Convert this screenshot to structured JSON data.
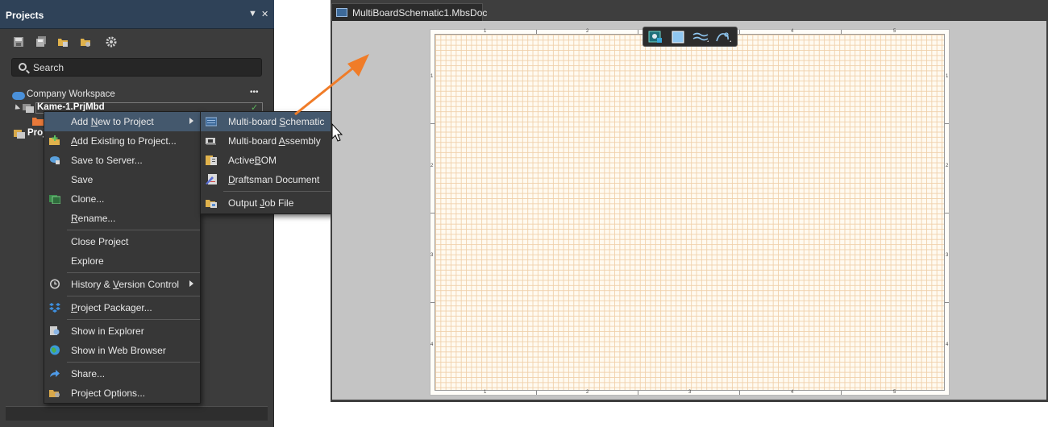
{
  "projects_panel": {
    "title": "Projects",
    "header_buttons": {
      "menu": "▼",
      "close": "✕"
    },
    "toolbar_icons": [
      "save-icon",
      "save-all-icon",
      "open-folder-icon",
      "folder-settings-icon",
      "gear-icon"
    ],
    "search": {
      "placeholder": "Search",
      "value": ""
    },
    "tree": {
      "workspace": "Company Workspace",
      "workspace_more": "•••",
      "project": "Kame-1.PrjMbd",
      "project_fragment": "Proj"
    }
  },
  "context_menu": {
    "items": [
      {
        "label_pre": "Add ",
        "label_key": "N",
        "label_post": "ew to Project",
        "icon": "none",
        "has_submenu": true,
        "highlighted": true
      },
      {
        "label_pre": "",
        "label_key": "A",
        "label_post": "dd Existing to Project...",
        "icon": "add-existing-icon"
      },
      {
        "label_pre": "Save to Server...",
        "label_key": "",
        "label_post": "",
        "icon": "cloud-save-icon"
      },
      {
        "label_pre": "Save",
        "label_key": "",
        "label_post": "",
        "icon": "none"
      },
      {
        "label_pre": "Clone...",
        "label_key": "",
        "label_post": "",
        "icon": "clone-icon"
      },
      {
        "label_pre": "",
        "label_key": "R",
        "label_post": "ename...",
        "icon": "none"
      },
      {
        "label_pre": "Close Project",
        "label_key": "",
        "label_post": "",
        "icon": "none"
      },
      {
        "label_pre": "Explore",
        "label_key": "",
        "label_post": "",
        "icon": "none"
      },
      {
        "label_pre": "History & ",
        "label_key": "V",
        "label_post": "ersion Control",
        "icon": "history-icon",
        "has_submenu": true
      },
      {
        "label_pre": "",
        "label_key": "P",
        "label_post": "roject Packager...",
        "icon": "dropbox-icon"
      },
      {
        "label_pre": "Show in Explorer",
        "label_key": "",
        "label_post": "",
        "icon": "explorer-icon"
      },
      {
        "label_pre": "Show in Web Browser",
        "label_key": "",
        "label_post": "",
        "icon": "globe-icon"
      },
      {
        "label_pre": "Share...",
        "label_key": "",
        "label_post": "",
        "icon": "share-icon"
      },
      {
        "label_pre": "Project Options...",
        "label_key": "",
        "label_post": "",
        "icon": "project-options-icon"
      }
    ]
  },
  "submenu": {
    "items": [
      {
        "label_pre": "Multi-board ",
        "label_key": "S",
        "label_post": "chematic",
        "icon": "multiboard-schematic-icon",
        "highlighted": true
      },
      {
        "label_pre": "Multi-board ",
        "label_key": "A",
        "label_post": "ssembly",
        "icon": "multiboard-assembly-icon"
      },
      {
        "label_pre": "Active",
        "label_key": "B",
        "label_post": "OM",
        "icon": "activebom-icon"
      },
      {
        "label_pre": "",
        "label_key": "D",
        "label_post": "raftsman Document",
        "icon": "draftsman-icon"
      },
      {
        "label_pre": "Output ",
        "label_key": "J",
        "label_post": "ob File",
        "icon": "output-job-icon"
      }
    ]
  },
  "editor": {
    "tab_label": "MultiBoardSchematic1.MbsDoc",
    "active_bar_icons": [
      "place-module-icon",
      "place-sheet-icon",
      "place-wire-icon",
      "place-harness-icon"
    ],
    "sheet_columns": [
      "1",
      "2",
      "3",
      "4",
      "5",
      "6"
    ],
    "sheet_rows": [
      "1",
      "2",
      "3",
      "4"
    ]
  },
  "colors": {
    "panel_bg": "#3c3c3c",
    "header_bg": "#2f4258",
    "menu_highlight": "#44586d",
    "callout_arrow": "#f07c28",
    "sheet_grid": "#f0d0aa"
  }
}
